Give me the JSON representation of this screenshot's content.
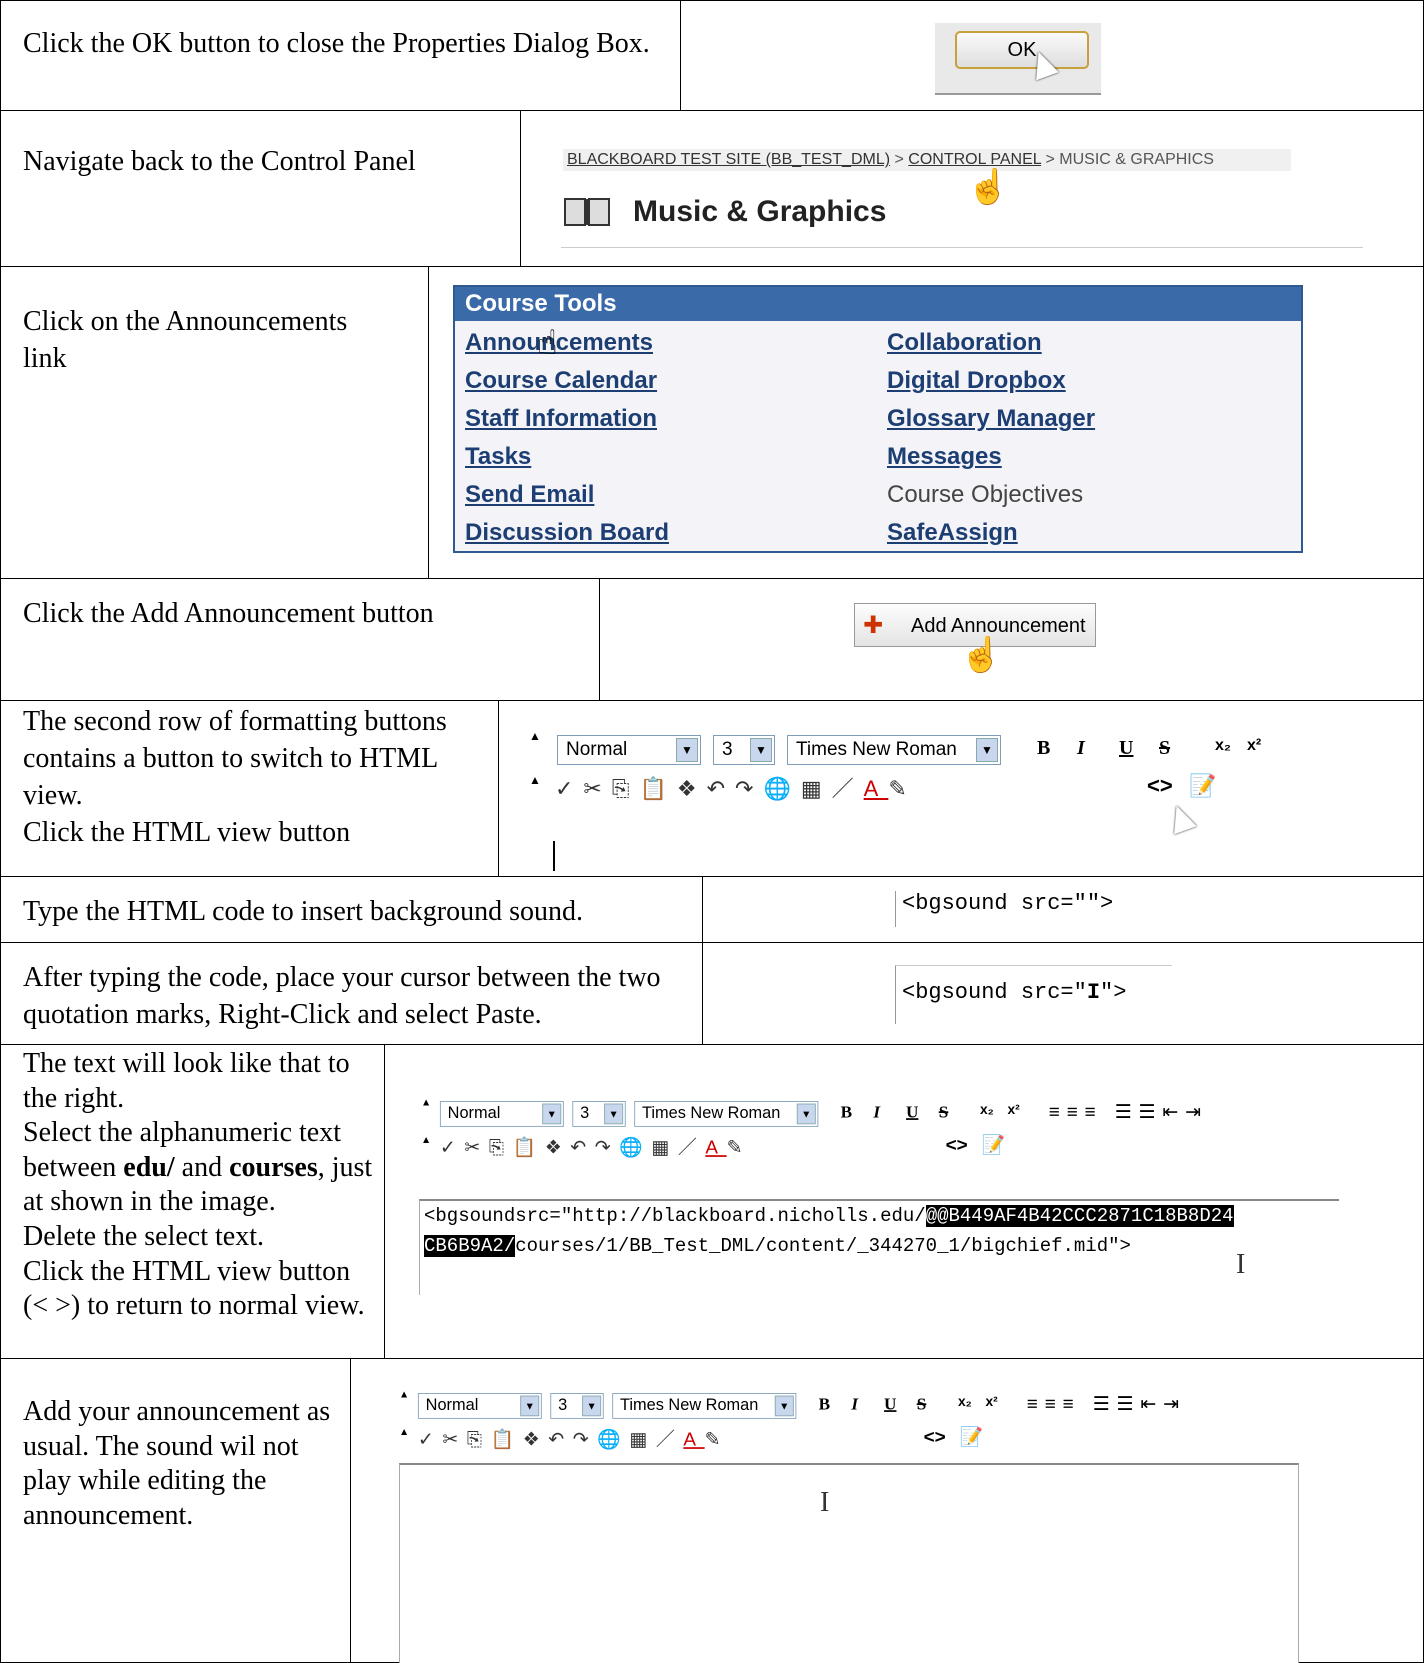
{
  "steps": [
    {
      "text": "Click the OK button to close the Properties Dialog Box."
    },
    {
      "text": "Navigate back to the Control Panel"
    },
    {
      "text": "Click on the Announcements link"
    },
    {
      "text": "Click the Add Announcement button"
    },
    {
      "text_lines": [
        "The second row of formatting buttons contains a button to switch to HTML view.",
        "Click the HTML view button"
      ]
    },
    {
      "text": "Type the HTML code to insert background sound."
    },
    {
      "text": "After typing the code, place your cursor between the two quotation marks, Right-Click and select Paste."
    },
    {
      "line1": "The text will look like that to the right.",
      "line2a": "Select the alphanumeric text between ",
      "bold1": "edu/",
      "line2b": " and ",
      "bold2": "courses",
      "line2c": ", just at shown in the image.",
      "line3": "Delete the select text.",
      "line4": "Click the HTML view button (< >) to return to normal view."
    },
    {
      "text": "Add your announcement as usual. The sound wil not play while editing the announcement."
    }
  ],
  "ok_button": {
    "label": "OK"
  },
  "breadcrumb": {
    "site": "BLACKBOARD TEST SITE (BB_TEST_DML)",
    "sep": " > ",
    "panel": "CONTROL PANEL",
    "current": "MUSIC & GRAPHICS"
  },
  "page_heading": "Music & Graphics",
  "course_tools": {
    "title": "Course Tools",
    "left": [
      "Announcements",
      "Course Calendar",
      "Staff Information",
      "Tasks",
      "Send Email",
      "Discussion Board"
    ],
    "right": [
      "Collaboration",
      "Digital Dropbox",
      "Glossary Manager",
      "Messages",
      "Course Objectives",
      "SafeAssign"
    ]
  },
  "add_announcement": {
    "label": "Add Announcement"
  },
  "toolbar": {
    "format": "Normal",
    "size": "3",
    "font": "Times New Roman"
  },
  "code": {
    "empty": "<bgsound src=\"\">",
    "with_cursor_a": "<bgsound src=\"",
    "with_cursor_b": "\">",
    "line1_pre": "<bgsoundsrc=\"http://blackboard.nicholls.edu/",
    "line1_hl": "@@B449AF4B42CCC2871C18B8D24",
    "line2_hl": "CB6B9A2/",
    "line2_post": "courses/1/BB_Test_DML/content/_344270_1/bigchief.mid\">"
  }
}
